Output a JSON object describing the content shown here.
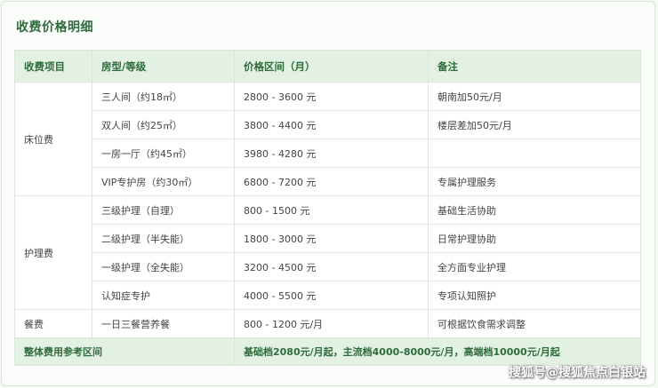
{
  "title": "收费价格明细",
  "headers": [
    "收费项目",
    "房型/等级",
    "价格区间（月）",
    "备注"
  ],
  "groups": {
    "bed": "床位费",
    "care": "护理费",
    "meal": "餐费"
  },
  "rows": [
    {
      "type": "三人间（约18㎡）",
      "price": "2800 - 3600 元",
      "note": "朝南加50元/月"
    },
    {
      "type": "双人间（约25㎡）",
      "price": "3800 - 4400 元",
      "note": "楼层差加50元/月"
    },
    {
      "type": "一房一厅（约45㎡）",
      "price": "3980 - 4280 元",
      "note": ""
    },
    {
      "type": "VIP专护房（约30㎡）",
      "price": "6800 - 7200 元",
      "note": "专属护理服务"
    },
    {
      "type": "三级护理（自理）",
      "price": "800 - 1500 元",
      "note": "基础生活协助"
    },
    {
      "type": "二级护理（半失能）",
      "price": "1800 - 3000 元",
      "note": "日常护理协助"
    },
    {
      "type": "一级护理（全失能）",
      "price": "3200 - 4500 元",
      "note": "全方面专业护理"
    },
    {
      "type": "认知症专护",
      "price": "4000 - 5500 元",
      "note": "专项认知照护"
    },
    {
      "type": "一日三餐营养餐",
      "price": "800 - 1200 元/月",
      "note": "可根据饮食需求调整"
    }
  ],
  "summary": {
    "label": "整体费用参考区间",
    "value": "基础档2080元/月起，主流档4000-8000元/月，高端档10000元/月起"
  },
  "watermark": "搜狐号@搜狐焦点白银站"
}
